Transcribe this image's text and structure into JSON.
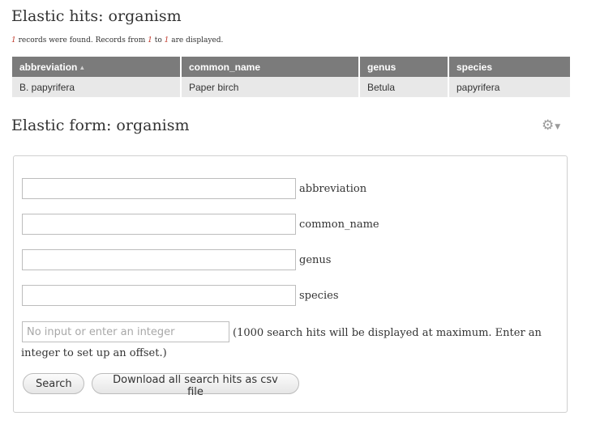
{
  "hits": {
    "title": "Elastic hits: organism",
    "records_count": "1",
    "records_text_1": " records were found. Records from ",
    "records_from": "1",
    "records_text_2": " to ",
    "records_to": "1",
    "records_text_3": " are displayed.",
    "columns": [
      "abbreviation",
      "common_name",
      "genus",
      "species"
    ],
    "sort_icon": "sort-ascending-icon",
    "rows": [
      [
        "B. papyrifera",
        "Paper birch",
        "Betula",
        "papyrifera"
      ]
    ]
  },
  "form": {
    "title": "Elastic form: organism",
    "gear_icon": "gear-icon",
    "fields": [
      {
        "label": "abbreviation",
        "value": ""
      },
      {
        "label": "common_name",
        "value": ""
      },
      {
        "label": "genus",
        "value": ""
      },
      {
        "label": "species",
        "value": ""
      }
    ],
    "offset_placeholder": "No input or enter an integer",
    "offset_note": "(1000 search hits will be displayed at maximum. Enter an integer to set up an offset.)",
    "search_label": "Search",
    "csv_label": "Download all search hits as csv file"
  },
  "colors": {
    "table_header_bg": "#7b7b7b",
    "table_row_bg": "#e8e8e8",
    "records_accent": "#c0392b"
  }
}
